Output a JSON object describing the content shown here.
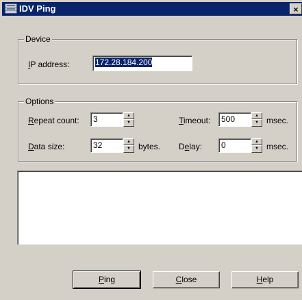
{
  "window": {
    "title": "IDV Ping",
    "close_label": "×"
  },
  "device": {
    "group_label": "Device",
    "ip_label_pre": "",
    "ip_label_u": "I",
    "ip_label_post": "P address:",
    "ip_value": "172.28.184.200"
  },
  "options": {
    "group_label": "Options",
    "repeat_label_u": "R",
    "repeat_label_post": "epeat count:",
    "repeat_value": "3",
    "timeout_label_u": "T",
    "timeout_label_post": "imeout:",
    "timeout_value": "500",
    "timeout_unit": "msec.",
    "datasize_label_u": "D",
    "datasize_label_post": "ata size:",
    "datasize_value": "32",
    "datasize_unit": "bytes.",
    "delay_label_pre": "D",
    "delay_label_u": "e",
    "delay_label_post": "lay:",
    "delay_value": "0",
    "delay_unit": "msec."
  },
  "buttons": {
    "ping_u": "P",
    "ping_post": "ing",
    "close_u": "C",
    "close_post": "lose",
    "help_u": "H",
    "help_post": "elp"
  }
}
